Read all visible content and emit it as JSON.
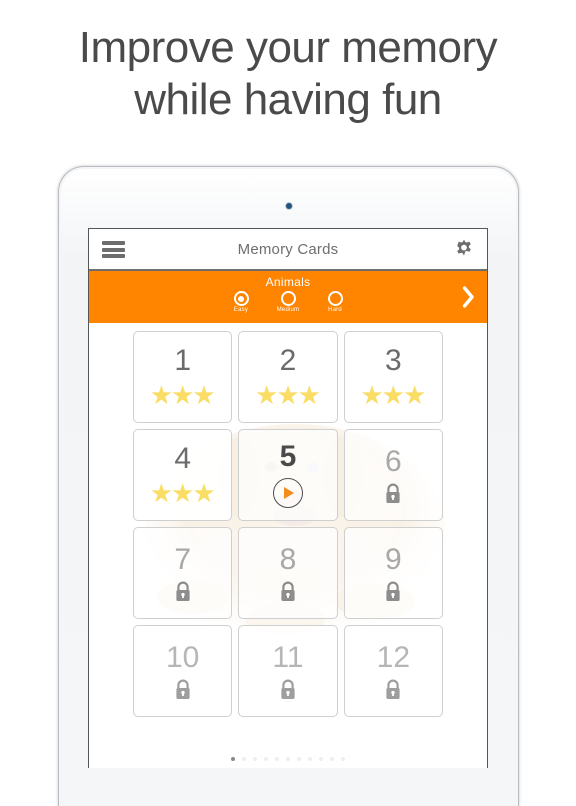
{
  "promo": {
    "headline": "Improve your memory\nwhile having fun"
  },
  "device": {
    "camera_icon": "camera-dot"
  },
  "app": {
    "title": "Memory Cards",
    "menu_icon": "hamburger-menu-icon",
    "settings_icon": "gear-icon"
  },
  "category": {
    "name": "Animals",
    "next_icon": "chevron-right-icon",
    "accent_color": "#ff8400",
    "difficulties": [
      {
        "label": "Easy",
        "selected": true
      },
      {
        "label": "Medium",
        "selected": false
      },
      {
        "label": "Hard",
        "selected": false
      }
    ]
  },
  "levels": [
    {
      "number": "1",
      "state": "completed",
      "stars": 3
    },
    {
      "number": "2",
      "state": "completed",
      "stars": 3
    },
    {
      "number": "3",
      "state": "completed",
      "stars": 3
    },
    {
      "number": "4",
      "state": "completed",
      "stars": 3
    },
    {
      "number": "5",
      "state": "current",
      "stars": 0,
      "icon": "play-icon"
    },
    {
      "number": "6",
      "state": "locked",
      "stars": 0,
      "icon": "lock-icon"
    },
    {
      "number": "7",
      "state": "locked",
      "stars": 0,
      "icon": "lock-icon"
    },
    {
      "number": "8",
      "state": "locked",
      "stars": 0,
      "icon": "lock-icon"
    },
    {
      "number": "9",
      "state": "locked",
      "stars": 0,
      "icon": "lock-icon"
    },
    {
      "number": "10",
      "state": "locked",
      "stars": 0,
      "icon": "lock-icon"
    },
    {
      "number": "11",
      "state": "locked",
      "stars": 0,
      "icon": "lock-icon"
    },
    {
      "number": "12",
      "state": "locked",
      "stars": 0,
      "icon": "lock-icon"
    }
  ],
  "pagination": {
    "total": 11,
    "active_index": 0
  },
  "colors": {
    "accent_orange": "#ff8400",
    "star_yellow": "#f9dd64",
    "text_gray": "#6b6b6b",
    "locked_gray": "#a8a8a8"
  }
}
